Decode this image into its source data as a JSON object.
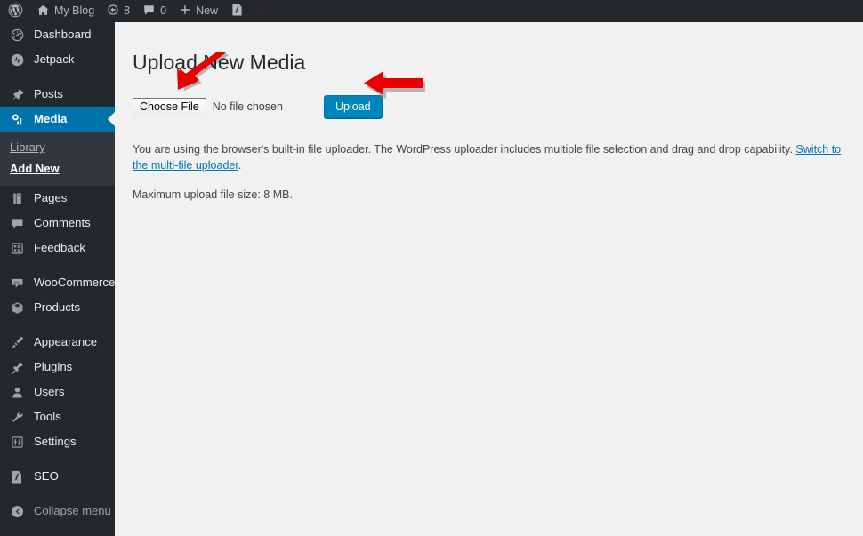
{
  "adminbar": {
    "items": [
      {
        "icon": "wordpress-logo-icon",
        "label": ""
      },
      {
        "icon": "home-icon",
        "label": "My Blog"
      },
      {
        "icon": "updates-icon",
        "label": "8"
      },
      {
        "icon": "comment-bubble-icon",
        "label": "0"
      },
      {
        "icon": "plus-icon",
        "label": "New"
      },
      {
        "icon": "yoast-seo-icon",
        "label": ""
      }
    ]
  },
  "sidebar": {
    "items": [
      {
        "label": "Dashboard",
        "icon": "dashboard-gauge-icon",
        "current": false
      },
      {
        "label": "Jetpack",
        "icon": "jetpack-icon",
        "current": false
      },
      {
        "label": "Posts",
        "icon": "pushpin-icon",
        "current": false
      },
      {
        "label": "Media",
        "icon": "media-camera-icon",
        "current": true
      },
      {
        "label": "Pages",
        "icon": "pages-icon",
        "current": false
      },
      {
        "label": "Comments",
        "icon": "comment-bubble-icon",
        "current": false
      },
      {
        "label": "Feedback",
        "icon": "feedback-form-icon",
        "current": false
      },
      {
        "label": "WooCommerce",
        "icon": "woocommerce-icon",
        "current": false
      },
      {
        "label": "Products",
        "icon": "product-box-icon",
        "current": false
      },
      {
        "label": "Appearance",
        "icon": "paintbrush-icon",
        "current": false
      },
      {
        "label": "Plugins",
        "icon": "plug-icon",
        "current": false
      },
      {
        "label": "Users",
        "icon": "user-icon",
        "current": false
      },
      {
        "label": "Tools",
        "icon": "wrench-icon",
        "current": false
      },
      {
        "label": "Settings",
        "icon": "settings-sliders-icon",
        "current": false
      },
      {
        "label": "SEO",
        "icon": "yoast-seo-icon",
        "current": false
      }
    ],
    "media_submenu": [
      {
        "label": "Library",
        "current": false
      },
      {
        "label": "Add New",
        "current": true
      }
    ],
    "collapse": {
      "label": "Collapse menu",
      "icon": "collapse-arrow-icon"
    }
  },
  "main": {
    "title": "Upload New Media",
    "choose_file_label": "Choose File",
    "file_name_text": "No file chosen",
    "upload_label": "Upload",
    "description_part1": "You are using the browser's built-in file uploader. The WordPress uploader includes multiple file selection and drag and drop capability. ",
    "description_link": "Switch to the multi-file uploader",
    "description_part2": ".",
    "max_upload": "Maximum upload file size: 8 MB."
  },
  "annotations": [
    {
      "name": "arrow-to-choose-file",
      "color": "#e60000",
      "direction": "down-left"
    },
    {
      "name": "arrow-to-upload",
      "color": "#e60000",
      "direction": "left"
    }
  ],
  "colors": {
    "adminbar_bg": "#23282d",
    "sidebar_bg": "#23282d",
    "submenu_bg": "#32373c",
    "current_menu": "#0073aa",
    "content_bg": "#f1f1f1",
    "button_blue": "#0085ba",
    "link_blue": "#0073aa",
    "annotation_red": "#e60000"
  }
}
